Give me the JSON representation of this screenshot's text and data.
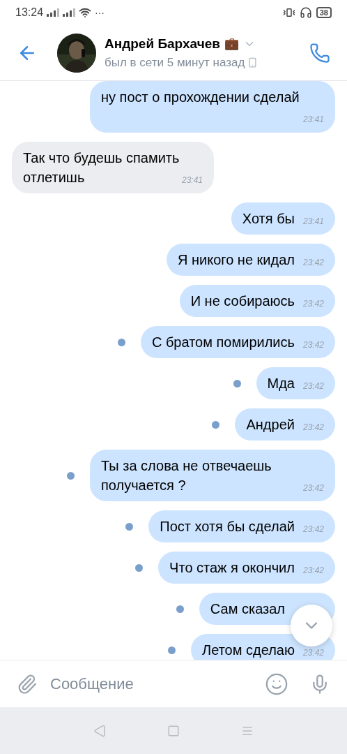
{
  "status_bar": {
    "time": "13:24",
    "more": "···",
    "battery": "38"
  },
  "header": {
    "name": "Андрей Бархачев",
    "emoji": "💼",
    "status": "был в сети 5 минут назад"
  },
  "messages": [
    {
      "kind": "outgoing",
      "text": "ну пост о прохождении сделай",
      "time": "23:41",
      "unread": false
    },
    {
      "kind": "incoming",
      "text": "Так что будешь спамить отлетишь",
      "time": "23:41",
      "unread": false
    },
    {
      "kind": "outgoing",
      "text": "Хотя бы",
      "time": "23:41",
      "unread": false
    },
    {
      "kind": "outgoing",
      "text": "Я никого не кидал",
      "time": "23:42",
      "unread": false
    },
    {
      "kind": "outgoing",
      "text": "И не собираюсь",
      "time": "23:42",
      "unread": false
    },
    {
      "kind": "outgoing",
      "text": "С братом помирились",
      "time": "23:42",
      "unread": true
    },
    {
      "kind": "outgoing",
      "text": "Мда",
      "time": "23:42",
      "unread": true
    },
    {
      "kind": "outgoing",
      "text": "Андрей",
      "time": "23:42",
      "unread": true
    },
    {
      "kind": "outgoing",
      "text": "Ты за слова не отвечаешь получается ?",
      "time": "23:42",
      "unread": true
    },
    {
      "kind": "outgoing",
      "text": "Пост хотя бы сделай",
      "time": "23:42",
      "unread": true
    },
    {
      "kind": "outgoing",
      "text": "Что стаж я окончил",
      "time": "23:42",
      "unread": true
    },
    {
      "kind": "outgoing",
      "text": "Сам сказал",
      "unread": true
    },
    {
      "kind": "outgoing",
      "text": "Летом сделаю",
      "time": "23:42",
      "unread": true
    }
  ],
  "composer": {
    "placeholder": "Сообщение"
  }
}
